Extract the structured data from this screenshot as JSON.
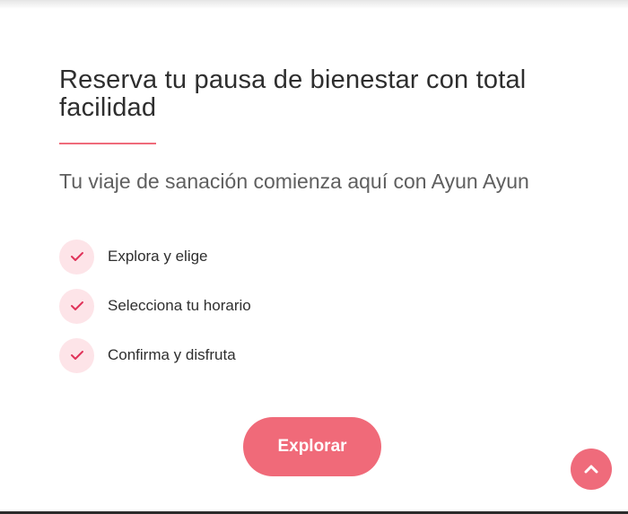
{
  "header": {
    "title": "Reserva tu pausa de bienestar con total facilidad",
    "subtitle": "Tu viaje de sanación comienza aquí con Ayun Ayun"
  },
  "steps": [
    {
      "label": "Explora y elige",
      "icon": "check-icon"
    },
    {
      "label": "Selecciona tu horario",
      "icon": "check-icon"
    },
    {
      "label": "Confirma y disfruta",
      "icon": "check-icon"
    }
  ],
  "cta": {
    "label": "Explorar"
  },
  "scroll_top": {
    "icon": "chevron-up-icon"
  },
  "colors": {
    "accent": "#f06a79",
    "badge_bg": "#fde4e8",
    "check": "#e0335a",
    "text_dark": "#2e2e2e",
    "text_muted": "#5f5f5f"
  }
}
